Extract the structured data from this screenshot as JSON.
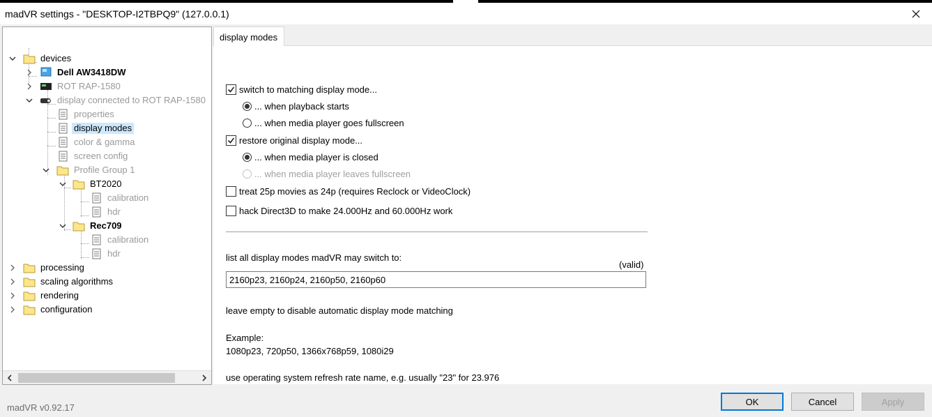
{
  "window": {
    "title": "madVR settings - \"DESKTOP-I2TBPQ9\" (127.0.0.1)"
  },
  "tree": {
    "devices": "devices",
    "dell": "Dell AW3418DW",
    "rot": "ROT RAP-1580",
    "display_connected": "display connected to ROT RAP-1580",
    "properties": "properties",
    "display_modes": "display modes",
    "color_gamma": "color & gamma",
    "screen_config": "screen config",
    "profile_group": "Profile Group 1",
    "bt2020": "BT2020",
    "bt2020_calibration": "calibration",
    "bt2020_hdr": "hdr",
    "rec709": "Rec709",
    "rec709_calibration": "calibration",
    "rec709_hdr": "hdr",
    "processing": "processing",
    "scaling": "scaling algorithms",
    "rendering": "rendering",
    "configuration": "configuration"
  },
  "tab": {
    "label": "display modes"
  },
  "page": {
    "switch_matching": {
      "label": "switch to matching display mode...",
      "checked": true
    },
    "when_playback_starts": {
      "label": "... when playback starts",
      "selected": true
    },
    "when_fullscreen": {
      "label": "... when media player goes fullscreen",
      "selected": false
    },
    "restore_original": {
      "label": "restore original display mode...",
      "checked": true
    },
    "when_closed": {
      "label": "... when media player is closed",
      "selected": true
    },
    "when_leaves_fullscreen": {
      "label": "... when media player leaves fullscreen",
      "selected": false,
      "disabled": true
    },
    "treat_25p": {
      "label": "treat 25p movies as 24p  (requires Reclock or VideoClock)",
      "checked": false
    },
    "hack_d3d": {
      "label": "hack Direct3D to make 24.000Hz and 60.000Hz work",
      "checked": false
    },
    "list_label": "list all display modes madVR may switch to:",
    "valid_label": "(valid)",
    "modes_value": "2160p23, 2160p24, 2160p50, 2160p60",
    "leave_empty": "leave empty to disable automatic display mode matching",
    "example_label": "Example:",
    "example_value": "1080p23, 720p50, 1366x768p59, 1080i29",
    "refresh_note": "use operating system refresh rate name, e.g. usually \"23\" for 23.976"
  },
  "footer": {
    "version": "madVR v0.92.17",
    "ok": "OK",
    "cancel": "Cancel",
    "apply": "Apply"
  },
  "colors": {
    "selection": "#cce8ff",
    "default_button_border": "#0078d7",
    "disabled_text": "#a0a0a0"
  }
}
